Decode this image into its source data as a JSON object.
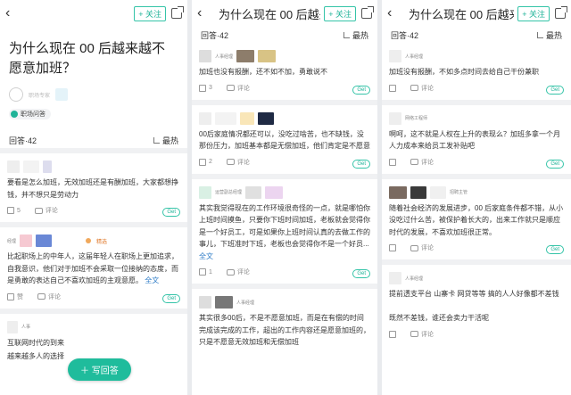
{
  "colors": {
    "accent": "#1fb398",
    "link": "#2f7cc7",
    "pick": "#e07a2c"
  },
  "icons": {
    "back": "chevron-left-icon",
    "share": "share-icon",
    "like": "thumb-up-icon",
    "comment": "comment-icon",
    "sort": "sort-icon"
  },
  "common": {
    "follow": "+ 关注",
    "answers_count": "回答·42",
    "sort": "最热",
    "answers_count_short": "回答·42",
    "comment": "评论",
    "get": "Get",
    "full": "全文"
  },
  "panel1": {
    "title": "为什么现在 00 后越来越不愿意加班？",
    "asker": "职场专家",
    "topic": "职场问答",
    "answers": [
      {
        "role": "",
        "text": "要看是怎么加班，无效加班还是有酬加班，大家都想挣钱，并不想只是劳动力",
        "likes": "5"
      },
      {
        "role": "经理",
        "pick": "精选",
        "text": "比起职场上的中年人，这届年轻人在职场上更加追求，自我意识，他们对于加班不会采取一位接纳的态度，而是勇敢的表达自己不喜欢加班的主观意愿。",
        "likes": "赞"
      },
      {
        "role": "人事",
        "text": "互联网时代的到来"
      }
    ],
    "cut_text": "越来越多人的选择",
    "fab": "写回答"
  },
  "panel2": {
    "title": "为什么现在 00 后越来越...",
    "answers": [
      {
        "role": "人事经理",
        "text": "加班也没有报酬，还不如不加，勇敢说不",
        "likes": "3"
      },
      {
        "role": "",
        "text": "00后家庭情况都还可以，没吃过啥苦，也不缺钱，没那份压力，加班基本都是无偿加班，他们肯定是不愿意",
        "likes": "2"
      },
      {
        "role": "运营副总经理",
        "text": "其实我觉得现在的工作环境很奇怪的一点，就是哪怕你上班时间摸鱼，只要你下班时间加班，老板就会觉得你是一个好员工，可是如果你上班时间认真的去做工作的事儿，下班准时下班，老板也会觉得你不是一个好员...",
        "likes": "1"
      },
      {
        "role": "人事经理",
        "text": "其实很多00后，不是不愿意加班，而是在有偿的时间完成该完成的工作，超出的工作内容还是愿意加班的，只是不愿意无效加班和无偿加班",
        "likes": ""
      }
    ]
  },
  "panel3": {
    "title": "为什么现在 00 后越来越不愿...",
    "answers": [
      {
        "role": "人事经理",
        "text": "加班没有报酬，不如多点时间去给自己干份兼职",
        "likes": ""
      },
      {
        "role": "网络工程师",
        "text": "啊呵，这不就是人权在上升的表现么？加班多拿一个月人力成本来给员工发补贴吧",
        "likes": ""
      },
      {
        "role": "招聘主管",
        "text": "随着社会经济的发展进步，00 后家庭条件都不错，从小没吃过什么苦，被保护着长大的，出来工作就只是顺应时代的发展，不喜欢加班很正常。",
        "likes": ""
      },
      {
        "role": "人事经理",
        "text": "提前透支平台 山寨卡 网贷等等 搞的人人好像都不差钱\n\n既然不差钱，谁还会卖力干活呢",
        "likes": ""
      }
    ]
  }
}
